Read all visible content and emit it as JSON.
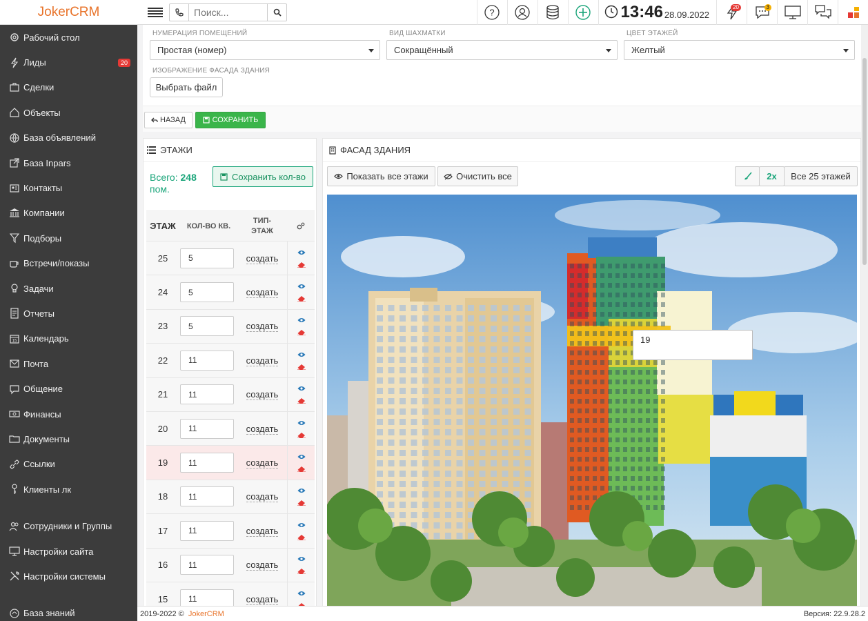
{
  "app": {
    "logo_text": "JokerCRM",
    "search_placeholder": "Поиск...",
    "clock_time": "13:46",
    "clock_date": "28.09.2022",
    "notif_badge": "20",
    "msg_badge": "3"
  },
  "sidebar": {
    "items": [
      {
        "label": "Рабочий стол",
        "icon": "gear-icon"
      },
      {
        "label": "Лиды",
        "icon": "bolt-icon",
        "badge": "20"
      },
      {
        "label": "Сделки",
        "icon": "briefcase-icon"
      },
      {
        "label": "Объекты",
        "icon": "home-icon"
      },
      {
        "label": "База объявлений",
        "icon": "globe-icon"
      },
      {
        "label": "База Inpars",
        "icon": "external-icon"
      },
      {
        "label": "Контакты",
        "icon": "contacts-icon"
      },
      {
        "label": "Компании",
        "icon": "bank-icon"
      },
      {
        "label": "Подборы",
        "icon": "filter-icon"
      },
      {
        "label": "Встречи/показы",
        "icon": "coffee-icon"
      },
      {
        "label": "Задачи",
        "icon": "bulb-icon"
      },
      {
        "label": "Отчеты",
        "icon": "report-icon"
      },
      {
        "label": "Календарь",
        "icon": "calendar-icon"
      },
      {
        "label": "Почта",
        "icon": "mail-icon"
      },
      {
        "label": "Общение",
        "icon": "chat-icon"
      },
      {
        "label": "Финансы",
        "icon": "money-icon"
      },
      {
        "label": "Документы",
        "icon": "folder-icon"
      },
      {
        "label": "Ссылки",
        "icon": "link-icon"
      },
      {
        "label": "Клиенты лк",
        "icon": "key-icon"
      }
    ],
    "items2": [
      {
        "label": "Сотрудники и Группы",
        "icon": "users-icon"
      },
      {
        "label": "Настройки сайта",
        "icon": "monitor-icon"
      },
      {
        "label": "Настройки системы",
        "icon": "tools-icon"
      }
    ],
    "items3": [
      {
        "label": "База знаний",
        "icon": "knowledge-icon"
      }
    ]
  },
  "settings": {
    "numbering_label": "НУМЕРАЦИЯ ПОМЕЩЕНИЙ",
    "numbering_value": "Простая (номер)",
    "chess_label": "ВИД ШАХМАТКИ",
    "chess_value": "Сокращённый",
    "color_label": "ЦВЕТ ЭТАЖЕЙ",
    "color_value": "Желтый",
    "facade_image_label": "ИЗОБРАЖЕНИЕ ФАСАДА ЗДАНИЯ",
    "choose_file": "Выбрать файл",
    "back": "НАЗАД",
    "save": "СОХРАНИТЬ"
  },
  "floors": {
    "title": "ЭТАЖИ",
    "total_prefix": "Всего:",
    "total_value": "248",
    "total_suffix": "пом.",
    "save_count": "Сохранить кол-во",
    "col_floor": "ЭТАЖ",
    "col_count": "КОЛ-ВО КВ.",
    "col_type_1": "ТИП-",
    "col_type_2": "ЭТАЖ",
    "create_label": "создать",
    "rows": [
      {
        "floor": "25",
        "count": "5"
      },
      {
        "floor": "24",
        "count": "5"
      },
      {
        "floor": "23",
        "count": "5"
      },
      {
        "floor": "22",
        "count": "11"
      },
      {
        "floor": "21",
        "count": "11"
      },
      {
        "floor": "20",
        "count": "11"
      },
      {
        "floor": "19",
        "count": "11",
        "active": true
      },
      {
        "floor": "18",
        "count": "11"
      },
      {
        "floor": "17",
        "count": "11"
      },
      {
        "floor": "16",
        "count": "11"
      },
      {
        "floor": "15",
        "count": "11"
      }
    ]
  },
  "facade": {
    "title": "ФАСАД ЗДАНИЯ",
    "show_all": "Показать все этажи",
    "clear_all": "Очистить все",
    "zoom": "2x",
    "all_floors": "Все 25 этажей",
    "tooltip_value": "19"
  },
  "footer": {
    "copyright": "2019-2022 ©",
    "brand": "JokerCRM",
    "version": "Версия: 22.9.28.2"
  },
  "colors": {
    "accent": "#e8732a",
    "sidebar_bg": "#3c3c3c",
    "green": "#1aa57a",
    "active_row": "#fbe9e9",
    "eye": "#2a7ab8",
    "eraser": "#e53935"
  }
}
